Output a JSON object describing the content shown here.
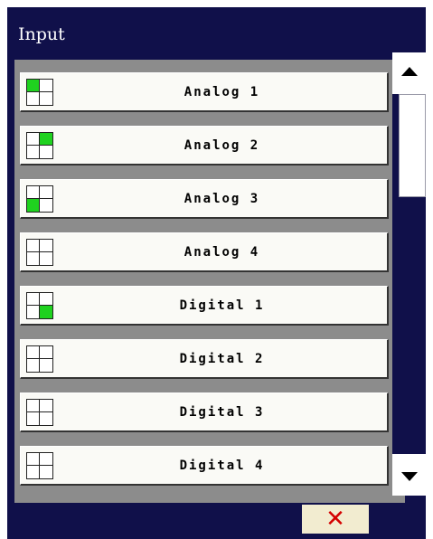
{
  "dialog": {
    "title": "Input"
  },
  "items": [
    {
      "label": "Analog 1",
      "indicator": [
        true,
        false,
        false,
        false
      ]
    },
    {
      "label": "Analog 2",
      "indicator": [
        false,
        true,
        false,
        false
      ]
    },
    {
      "label": "Analog 3",
      "indicator": [
        false,
        false,
        true,
        false
      ]
    },
    {
      "label": "Analog 4",
      "indicator": [
        false,
        false,
        false,
        false
      ]
    },
    {
      "label": "Digital 1",
      "indicator": [
        false,
        false,
        false,
        true
      ]
    },
    {
      "label": "Digital 2",
      "indicator": [
        false,
        false,
        false,
        false
      ]
    },
    {
      "label": "Digital 3",
      "indicator": [
        false,
        false,
        false,
        false
      ]
    },
    {
      "label": "Digital 4",
      "indicator": [
        false,
        false,
        false,
        false
      ]
    }
  ],
  "scrollbar": {
    "up_icon": "triangle-up-icon",
    "down_icon": "triangle-down-icon"
  },
  "footer": {
    "close_icon": "x-close-icon",
    "close_glyph": "✕"
  },
  "colors": {
    "background": "#10104a",
    "list_background": "#8c8c8c",
    "indicator_on": "#1fd21f",
    "close_mark": "#d40000",
    "close_button": "#f2ecd0"
  }
}
